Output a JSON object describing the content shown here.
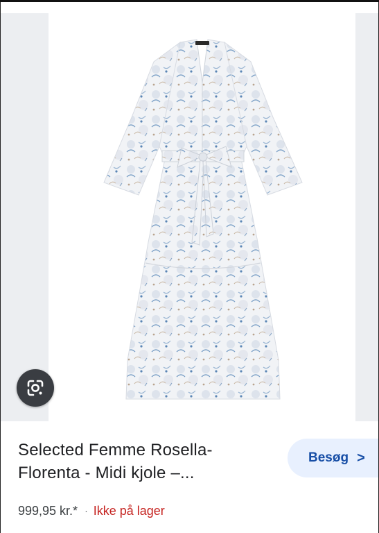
{
  "product": {
    "title_line1": "Selected Femme Rosella-",
    "title_line2": "Florenta - Midi kjole –...",
    "price": "999,95 kr.*",
    "separator": "·",
    "stock_status": "Ikke på lager"
  },
  "actions": {
    "visit_label": "Besøg",
    "visit_chevron": ">"
  },
  "icons": {
    "lens": "google-lens-icon"
  },
  "colors": {
    "visit_bg": "#e8f0fe",
    "visit_text": "#174ea6",
    "stock_text": "#c5221f",
    "lens_bg": "#3a3d42"
  }
}
